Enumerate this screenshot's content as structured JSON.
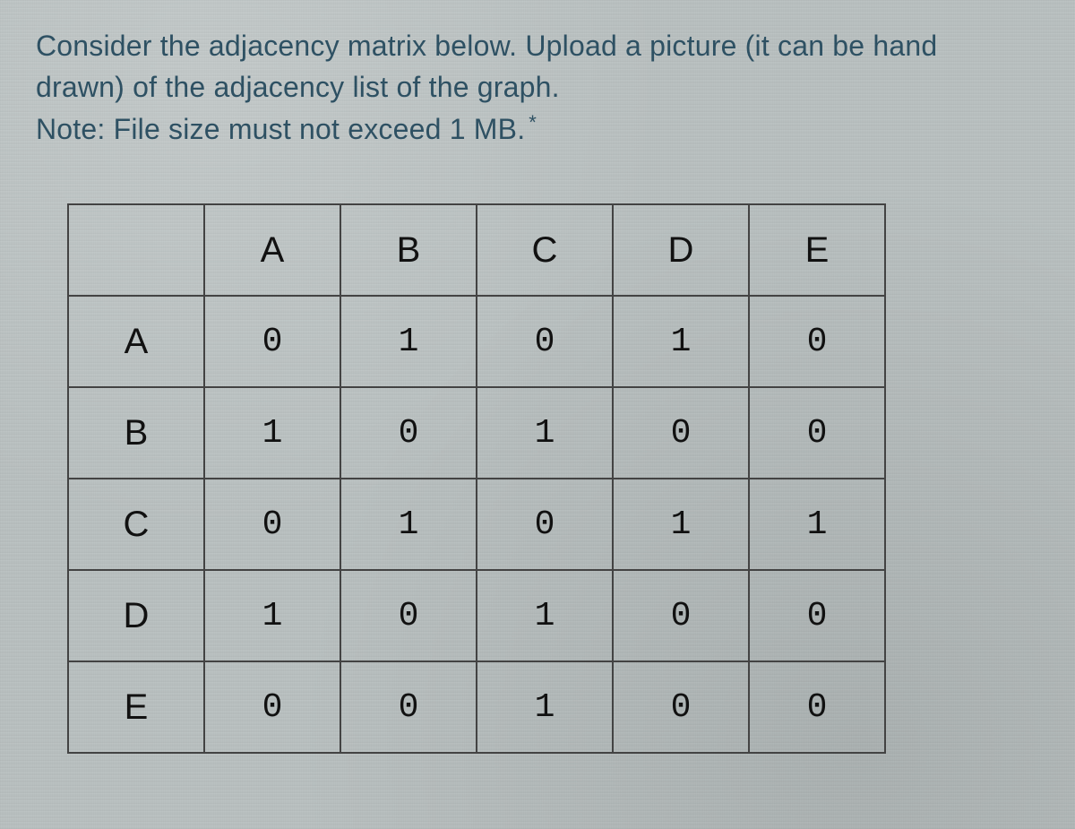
{
  "prompt": {
    "line1": "Consider the adjacency matrix below. Upload a picture (it can be hand",
    "line2": "drawn) of the adjacency list of the graph.",
    "line3_prefix": "Note: File size must not exceed 1 MB.",
    "required_marker": "*"
  },
  "matrix": {
    "col_headers": [
      "A",
      "B",
      "C",
      "D",
      "E"
    ],
    "row_headers": [
      "A",
      "B",
      "C",
      "D",
      "E"
    ],
    "cells": [
      [
        "0",
        "1",
        "0",
        "1",
        "0"
      ],
      [
        "1",
        "0",
        "1",
        "0",
        "0"
      ],
      [
        "0",
        "1",
        "0",
        "1",
        "1"
      ],
      [
        "1",
        "0",
        "1",
        "0",
        "0"
      ],
      [
        "0",
        "0",
        "1",
        "0",
        "0"
      ]
    ]
  },
  "chart_data": {
    "type": "table",
    "title": "Adjacency matrix",
    "categories": [
      "A",
      "B",
      "C",
      "D",
      "E"
    ],
    "series": [
      {
        "name": "A",
        "values": [
          0,
          1,
          0,
          1,
          0
        ]
      },
      {
        "name": "B",
        "values": [
          1,
          0,
          1,
          0,
          0
        ]
      },
      {
        "name": "C",
        "values": [
          0,
          1,
          0,
          1,
          1
        ]
      },
      {
        "name": "D",
        "values": [
          1,
          0,
          1,
          0,
          0
        ]
      },
      {
        "name": "E",
        "values": [
          0,
          0,
          1,
          0,
          0
        ]
      }
    ]
  }
}
